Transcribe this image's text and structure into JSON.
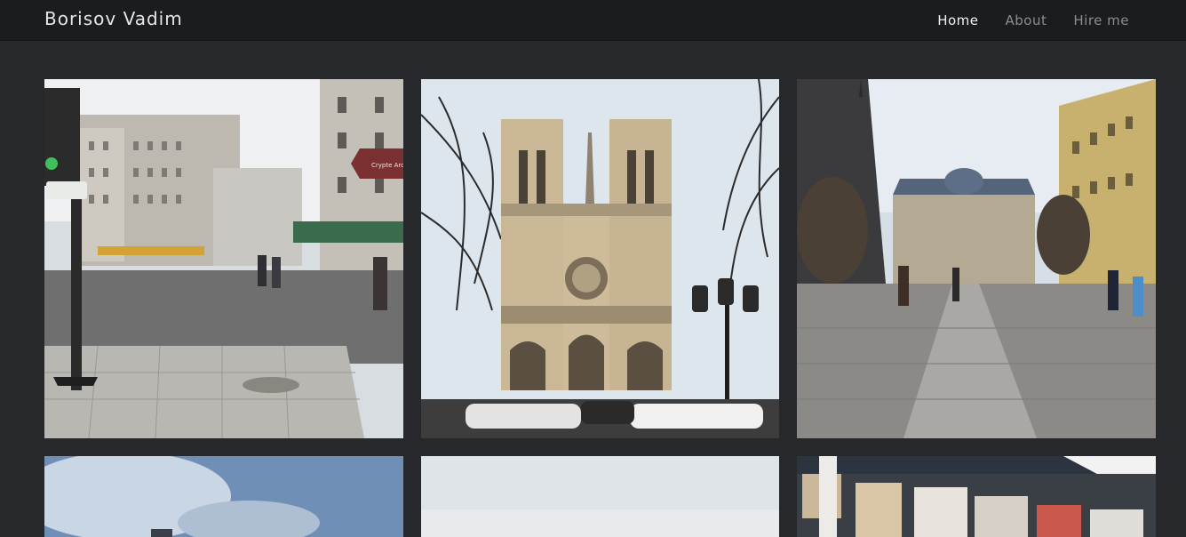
{
  "navbar": {
    "brand": "Borisov Vadim",
    "links": [
      {
        "label": "Home",
        "active": true
      },
      {
        "label": "About",
        "active": false
      },
      {
        "label": "Hire me",
        "active": false
      }
    ]
  },
  "colors": {
    "background": "#27282c",
    "navbar_bg": "#1b1c1f",
    "nav_active": "#f2f2f2",
    "nav_inactive": "#8c8d91"
  },
  "gallery": {
    "photos": [
      {
        "subject": "paris-street-corner-photo",
        "sign_text": "Crypte Archéo de Paris Not"
      },
      {
        "subject": "notre-dame-cathedral-photo"
      },
      {
        "subject": "palais-de-justice-plaza-photo"
      },
      {
        "subject": "cloudy-sky-photo"
      },
      {
        "subject": "overcast-sky-photo"
      },
      {
        "subject": "bouquinistes-stall-photo"
      }
    ]
  }
}
